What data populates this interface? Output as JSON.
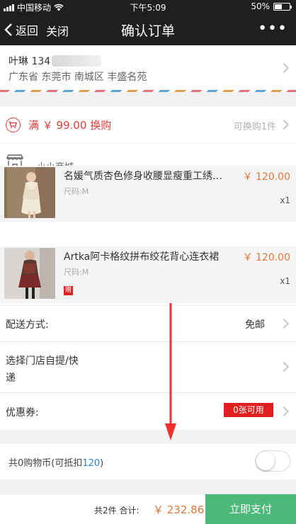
{
  "status_bar": {
    "carrier": "中国移动",
    "time": "下午5:09",
    "battery": "50%",
    "battery_level": 0.5
  },
  "nav": {
    "back_label": "返回",
    "close_label": "关闭",
    "title": "确认订单",
    "more_icon": "more-dots-icon"
  },
  "address": {
    "name": "叶琳 134",
    "region": "广东省 东莞市 南城区 丰盛名苑"
  },
  "swap": {
    "text": "满 ￥ 99.00 换购",
    "hint": "可换购1件",
    "icon": "cart-icon"
  },
  "shop": {
    "name": "小小商城",
    "items": [
      {
        "title": "名媛气质杏色修身收腰显瘦重工绣…",
        "spec": "尺码:M",
        "price": "￥ 120.00",
        "qty": "x1"
      },
      {
        "title": "Artka阿卡格纹拼布绞花背心连衣裙",
        "spec": "尺码:M",
        "price": "￥ 120.00",
        "qty": "x1",
        "gift": "赠"
      }
    ]
  },
  "delivery": {
    "label": "配送方式:",
    "value": "免邮"
  },
  "pickup": {
    "label_line1": "选择门店自提/快",
    "label_line2": "递"
  },
  "coupon": {
    "label": "优惠券:",
    "badge": "0张可用"
  },
  "coins": {
    "label_prefix": "共0购物币(可抵扣",
    "amount": "120",
    "label_suffix": ")",
    "enabled": false
  },
  "footer": {
    "count": "共2件 合计:",
    "total": "￥ 232.86",
    "pay_label": "立即支付"
  },
  "colors": {
    "accent_red": "#e02020",
    "price_orange": "#e2773a",
    "pay_green": "#4cb87a",
    "link_blue": "#2a84c8"
  }
}
